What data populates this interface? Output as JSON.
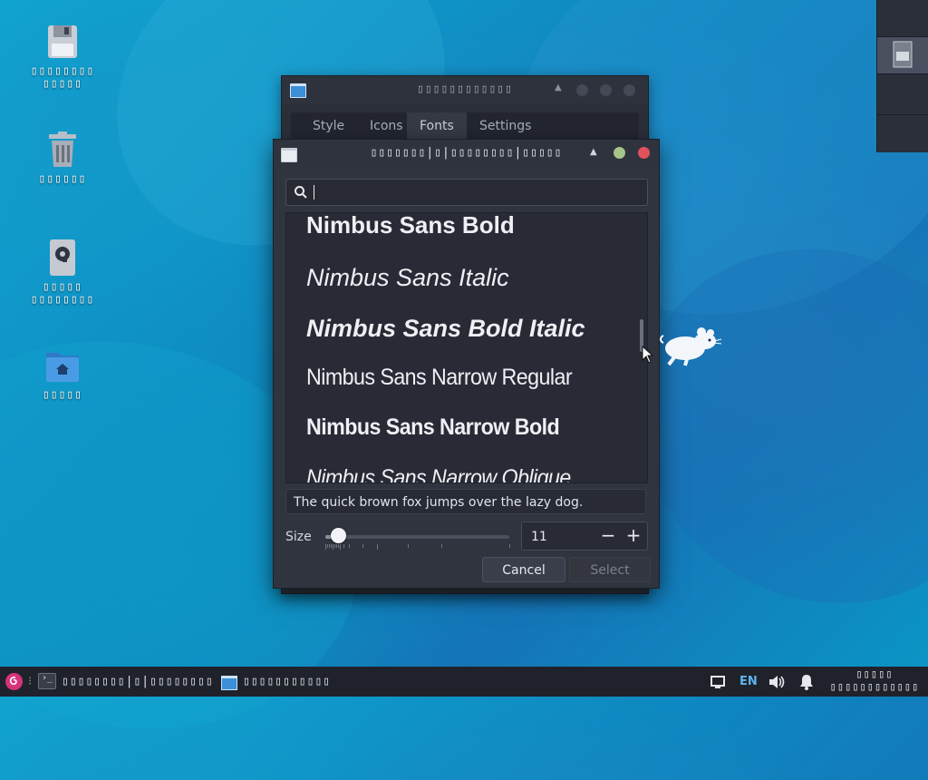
{
  "desktop": {
    "icons": [
      {
        "label": "▯▯▯▯▯▯▯▯\n▯▯▯▯▯",
        "icon": "floppy-disk-icon"
      },
      {
        "label": "▯▯▯▯▯▯",
        "icon": "trash-icon"
      },
      {
        "label": "▯▯▯▯▯\n▯▯▯▯▯▯▯▯",
        "icon": "hard-drive-icon"
      },
      {
        "label": "▯▯▯▯▯",
        "icon": "home-folder-icon"
      }
    ]
  },
  "background_window": {
    "title": "▯▯▯▯▯▯▯▯▯▯▯▯",
    "tabs": [
      "Style",
      "Icons",
      "Fonts",
      "Settings"
    ],
    "active_tab": "Fonts"
  },
  "dialog": {
    "title": "▯▯▯▯▯▯▯|▯|▯▯▯▯▯▯▯▯|▯▯▯▯▯",
    "search": {
      "value": "",
      "placeholder": ""
    },
    "fonts": [
      {
        "name": "Nimbus Sans Bold",
        "weight": "bold",
        "style": "normal"
      },
      {
        "name": "Nimbus Sans Italic",
        "weight": "normal",
        "style": "italic"
      },
      {
        "name": "Nimbus Sans Bold Italic",
        "weight": "bold",
        "style": "italic"
      },
      {
        "name": "Nimbus Sans Narrow Regular",
        "weight": "normal",
        "style": "normal"
      },
      {
        "name": "Nimbus Sans Narrow Bold",
        "weight": "bold",
        "style": "normal"
      },
      {
        "name": "Nimbus Sans Narrow Oblique",
        "weight": "normal",
        "style": "italic"
      }
    ],
    "preview_text": "The quick brown fox jumps over the lazy dog.",
    "size_label": "Size",
    "size_value": "11",
    "size_slider_fraction": 0.07,
    "minus_label": "−",
    "plus_label": "+",
    "cancel_label": "Cancel",
    "select_label": "Select",
    "scroll_position_fraction": 0.45,
    "colors": {
      "close": "#e0525c",
      "maximize": "#a4c48b",
      "accent": "#3a9fd8"
    }
  },
  "taskbar": {
    "task1_label": "▯▯▯▯▯▯▯▯|▯|▯▯▯▯▯▯▯▯",
    "task2_label": "▯▯▯▯▯▯▯▯▯▯▯",
    "language": "EN",
    "clock_line1": "▯▯▯▯▯",
    "clock_line2": "▯▯▯▯▯▯▯▯▯▯▯▯"
  }
}
